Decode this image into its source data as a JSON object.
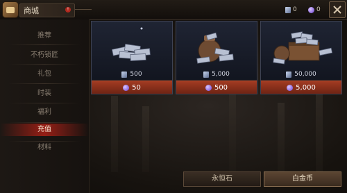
{
  "header": {
    "title": "商城",
    "notice_badge": "!",
    "gem_count": "0",
    "orb_count": "0",
    "close_icon": "close-icon"
  },
  "sidebar": {
    "items": [
      {
        "label": "推荐",
        "active": false
      },
      {
        "label": "不朽锁匠",
        "active": false
      },
      {
        "label": "礼包",
        "active": false
      },
      {
        "label": "时装",
        "active": false
      },
      {
        "label": "福利",
        "active": false
      },
      {
        "label": "充值",
        "active": true
      },
      {
        "label": "材料",
        "active": false
      }
    ]
  },
  "products": [
    {
      "amount": "500",
      "price": "50",
      "icon": "silver-pile-small"
    },
    {
      "amount": "5,000",
      "price": "500",
      "icon": "silver-sack"
    },
    {
      "amount": "50,000",
      "price": "5,000",
      "icon": "silver-chest"
    }
  ],
  "bottom_tabs": [
    {
      "label": "永恒石",
      "active": false
    },
    {
      "label": "白金币",
      "active": true
    }
  ],
  "colors": {
    "accent_red": "#a23b22",
    "active_tab_red": "#ac2016",
    "orb_purple": "#6b3fd1"
  }
}
